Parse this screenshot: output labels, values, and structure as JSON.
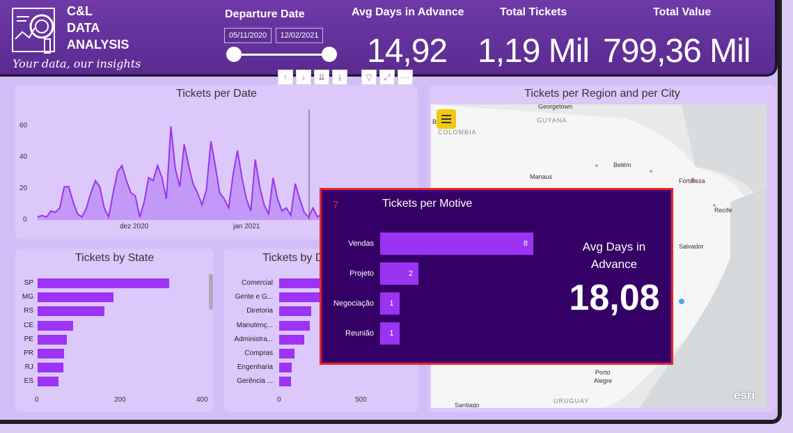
{
  "header": {
    "logo_lines": [
      "C&L",
      "DATA",
      "ANALYSIS"
    ],
    "tagline": "Your data, our insights",
    "departure_label": "Departure Date",
    "date_start": "05/11/2020",
    "date_end": "12/02/2021",
    "kpis": [
      {
        "label": "Avg Days in Advance",
        "value": "14,92"
      },
      {
        "label": "Total Tickets",
        "value": "1,19 Mil"
      },
      {
        "label": "Total Value",
        "value": "799,36 Mil"
      }
    ]
  },
  "toolbar": {
    "icons": [
      "arrow-up-icon",
      "arrow-down-icon",
      "double-arrow-down-icon",
      "expand-hierarchy-icon",
      "filter-icon",
      "focus-mode-icon",
      "more-options-icon"
    ],
    "glyphs": [
      "↑",
      "↓",
      "⇊",
      "⤓",
      "▽",
      "⤢",
      "···"
    ]
  },
  "tickets_per_date": {
    "title": "Tickets per Date",
    "y_ticks": [
      "60",
      "40",
      "20",
      "0"
    ],
    "x_ticks": [
      "dez 2020",
      "jan 2021"
    ],
    "chart_data": {
      "type": "area",
      "ylim": [
        0,
        70
      ],
      "values": [
        2,
        3,
        2,
        6,
        5,
        8,
        22,
        22,
        12,
        4,
        2,
        8,
        18,
        26,
        22,
        8,
        2,
        18,
        32,
        36,
        26,
        18,
        16,
        2,
        12,
        28,
        26,
        36,
        28,
        14,
        62,
        34,
        22,
        50,
        36,
        24,
        18,
        10,
        20,
        52,
        36,
        18,
        14,
        8,
        30,
        46,
        28,
        14,
        6,
        40,
        22,
        10,
        4,
        28,
        14,
        6,
        8,
        3,
        24,
        14,
        5,
        2,
        8,
        2,
        4,
        10,
        5,
        2,
        3,
        10,
        4,
        1,
        4,
        9,
        4,
        2,
        5,
        12,
        8,
        2,
        14,
        10,
        4,
        6,
        12
      ]
    }
  },
  "tickets_by_state": {
    "title": "Tickets by State",
    "x_ticks": [
      "0",
      "200",
      "400"
    ],
    "chart_data": {
      "type": "bar",
      "xlim": [
        0,
        400
      ],
      "categories": [
        "SP",
        "MG",
        "RS",
        "CE",
        "PE",
        "PR",
        "RJ",
        "ES"
      ],
      "values": [
        320,
        185,
        163,
        87,
        72,
        65,
        62,
        50
      ]
    }
  },
  "tickets_by_department": {
    "title": "Tickets by D",
    "x_ticks": [
      "0",
      "500"
    ],
    "chart_data": {
      "type": "bar",
      "xlim": [
        0,
        500
      ],
      "categories": [
        "Comercial",
        "Gente e G...",
        "Diretoria",
        "Manutenç...",
        "Administra...",
        "Compras",
        "Engenharia",
        "Gerência ..."
      ],
      "values": [
        260,
        175,
        95,
        92,
        75,
        45,
        38,
        35
      ]
    }
  },
  "map": {
    "title": "Tickets per Region and per City",
    "labels": [
      "Georgetown",
      "GUYANA",
      "COLOMBIA",
      "B",
      "Manaus",
      "Belém",
      "Fortaleza",
      "Recife",
      "Salvador",
      "Porto",
      "Alegre",
      "Santiago",
      "URUGUAY",
      "esri"
    ]
  },
  "popup": {
    "number": "7",
    "title": "Tickets per Motive",
    "chart_data": {
      "type": "bar",
      "xlim": [
        0,
        8
      ],
      "categories": [
        "Vendas",
        "Projeto",
        "Negociação",
        "Reunião"
      ],
      "values": [
        8,
        2,
        1,
        1
      ],
      "value_labels": [
        "8",
        "2",
        "1",
        "1"
      ]
    },
    "avg_label": "Avg Days in Advance",
    "avg_value": "18,08"
  }
}
